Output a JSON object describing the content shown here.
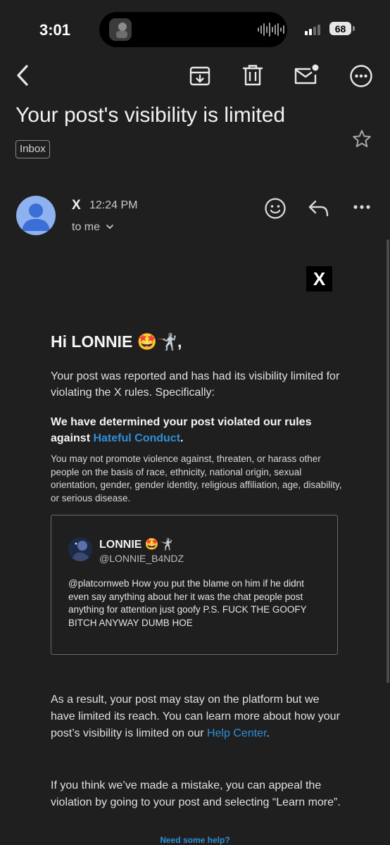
{
  "status_bar": {
    "time": "3:01",
    "battery": "68"
  },
  "toolbar": {
    "icons": [
      "back-icon",
      "archive-icon",
      "trash-icon",
      "mark-unread-icon",
      "more-icon"
    ]
  },
  "email": {
    "subject": "Your post's visibility is limited",
    "label": "Inbox",
    "sender": "X",
    "time": "12:24 PM",
    "recipient": "to me",
    "body": {
      "logo": "X",
      "greeting": "Hi LONNIE 🤩🤺,",
      "intro": "Your post was reported and has had its visibility limited for violating the X rules. Specifically:",
      "determination": "We have determined your post violated our rules against ",
      "determination_link": "Hateful Conduct",
      "determination_end": ".",
      "policy": "You may not promote violence against, threaten, or harass other people on the basis of race, ethnicity, national origin, sexual orientation, gender, gender identity, religious affiliation, age, disability, or serious disease.",
      "tweet": {
        "name": "LONNIE 🤩🤺",
        "handle": "@LONNIE_B4NDZ",
        "text": "@platcornweb How you put the blame on him if he didnt even say anything about her it was the chat people post anything for attention just goofy P.S. FUCK THE GOOFY BITCH ANYWAY DUMB HOE"
      },
      "result": "As a result, your post may stay on the platform but we have limited its reach. You can learn more about how your post’s visibility is limited on our ",
      "result_link": "Help Center",
      "result_end": ".",
      "appeal": "If you think we’ve made a mistake, you can appeal the violation by going to your post and selecting “Learn more”.",
      "footer_link": "Need some help?"
    }
  },
  "colors": {
    "background": "#1f1f20",
    "link": "#2f8fd6",
    "avatar": "#8eb1ef"
  }
}
